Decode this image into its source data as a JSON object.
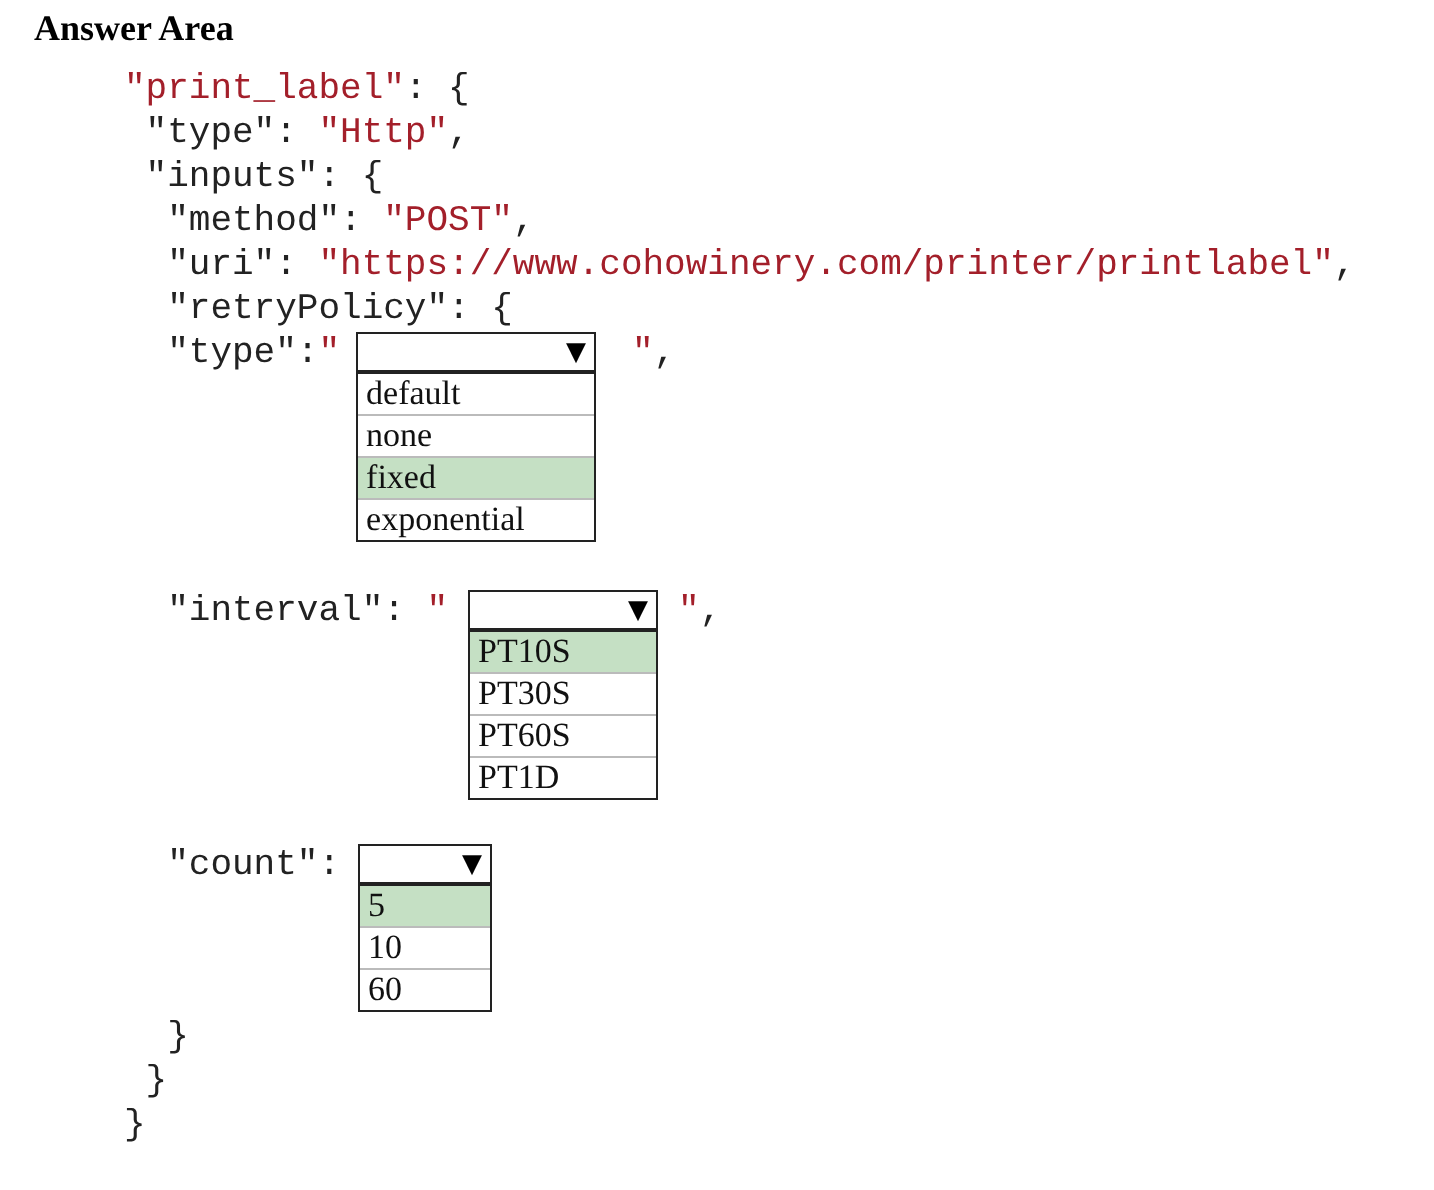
{
  "heading": "Answer Area",
  "lines": [
    {
      "tokens": [
        {
          "kind": "string",
          "text": "\"print_label\""
        },
        {
          "kind": "plain",
          "text": ": {"
        }
      ]
    },
    {
      "tokens": [
        {
          "kind": "plain",
          "text": " \"type\": "
        },
        {
          "kind": "string",
          "text": "\"Http\""
        },
        {
          "kind": "plain",
          "text": ","
        }
      ]
    },
    {
      "tokens": [
        {
          "kind": "plain",
          "text": " \"inputs\": {"
        }
      ]
    },
    {
      "tokens": [
        {
          "kind": "plain",
          "text": "  \"method\": "
        },
        {
          "kind": "string",
          "text": "\"POST\""
        },
        {
          "kind": "plain",
          "text": ","
        }
      ]
    },
    {
      "tokens": [
        {
          "kind": "plain",
          "text": "  \"uri\": "
        },
        {
          "kind": "string",
          "text": "\"https://www.cohowinery.com/printer/printlabel\""
        },
        {
          "kind": "plain",
          "text": ","
        }
      ]
    },
    {
      "tokens": [
        {
          "kind": "plain",
          "text": "  \"retryPolicy\": {"
        }
      ]
    },
    {
      "tokens": [
        {
          "kind": "plain",
          "text": "  \"type\":"
        },
        {
          "kind": "string",
          "text": "\""
        },
        {
          "kind": "dropdown",
          "arrow": "▼",
          "options": [
            {
              "label": "default",
              "selected": false
            },
            {
              "label": "none",
              "selected": false
            },
            {
              "label": "fixed",
              "selected": true
            },
            {
              "label": "exponential",
              "selected": false
            }
          ]
        },
        {
          "kind": "string",
          "text": "\""
        },
        {
          "kind": "plain",
          "text": ","
        }
      ]
    },
    {
      "tokens": [
        {
          "kind": "plain",
          "text": "  \"interval\": "
        },
        {
          "kind": "string",
          "text": "\""
        },
        {
          "kind": "dropdown",
          "arrow": "▼",
          "options": [
            {
              "label": "PT10S",
              "selected": true
            },
            {
              "label": "PT30S",
              "selected": false
            },
            {
              "label": "PT60S",
              "selected": false
            },
            {
              "label": "PT1D",
              "selected": false
            }
          ]
        },
        {
          "kind": "string",
          "text": "\""
        },
        {
          "kind": "plain",
          "text": ","
        }
      ]
    },
    {
      "tokens": [
        {
          "kind": "plain",
          "text": "  \"count\":"
        },
        {
          "kind": "dropdown",
          "arrow": "▼",
          "options": [
            {
              "label": "5",
              "selected": true
            },
            {
              "label": "10",
              "selected": false
            },
            {
              "label": "60",
              "selected": false
            }
          ]
        }
      ]
    },
    {
      "tokens": [
        {
          "kind": "plain",
          "text": "  }"
        }
      ]
    },
    {
      "tokens": [
        {
          "kind": "plain",
          "text": " }"
        }
      ]
    },
    {
      "tokens": [
        {
          "kind": "plain",
          "text": "}"
        }
      ]
    }
  ]
}
